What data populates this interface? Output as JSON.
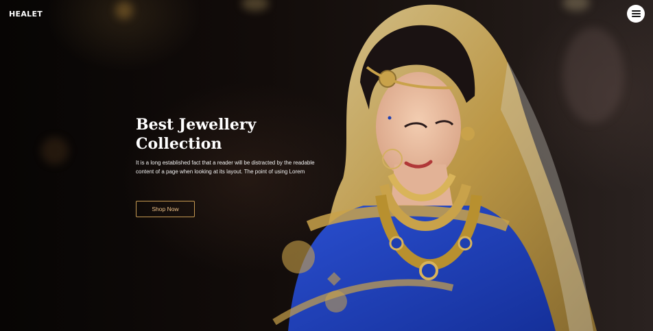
{
  "header": {
    "brand": "HEALET",
    "menu_icon": "hamburger-menu-icon"
  },
  "hero": {
    "headline_line1": "Best Jewellery",
    "headline_line2": "Collection",
    "description": "It is a long established fact that a reader will be distracted by the readable content of a page when looking at its layout. The point of using Lorem",
    "cta_label": "Shop Now",
    "image_alt": "bride-in-blue-saree-with-gold-jewellery"
  },
  "colors": {
    "background": "#0b0706",
    "cta_border": "#c79a52",
    "cta_text": "#f0c48a",
    "saree_blue": "#1f3fb0",
    "gold": "#c9a24a"
  }
}
